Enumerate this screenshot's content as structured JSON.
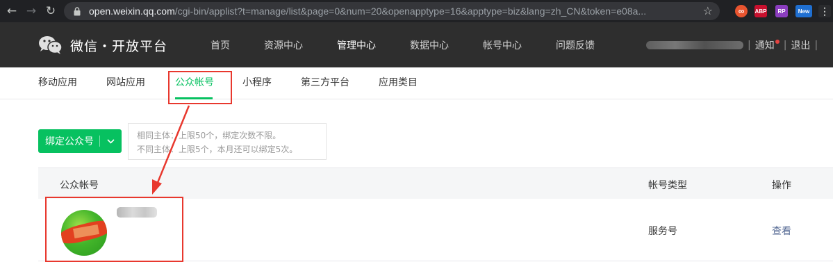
{
  "browser": {
    "url_host": "open.weixin.qq.com",
    "url_path": "/cgi-bin/applist?t=manage/list&page=0&num=20&openapptype=16&apptype=biz&lang=zh_CN&token=e08a...",
    "extensions": [
      "∞",
      "ABP",
      "RP",
      "New"
    ]
  },
  "header": {
    "logo_text": "微信・开放平台",
    "nav": [
      "首页",
      "资源中心",
      "管理中心",
      "数据中心",
      "帐号中心",
      "问题反馈"
    ],
    "active_nav": "管理中心",
    "notify_label": "通知",
    "logout_label": "退出"
  },
  "subnav": {
    "items": [
      "移动应用",
      "网站应用",
      "公众帐号",
      "小程序",
      "第三方平台",
      "应用类目"
    ],
    "active": "公众帐号"
  },
  "bind": {
    "button_label": "绑定公众号",
    "tip_line1": "相同主体：上限50个，绑定次数不限。",
    "tip_line2": "不同主体：上限5个，本月还可以绑定5次。"
  },
  "table": {
    "headers": [
      "公众帐号",
      "帐号类型",
      "操作"
    ],
    "rows": [
      {
        "account_type": "服务号",
        "action": "查看"
      }
    ]
  },
  "colors": {
    "accent": "#07c160",
    "header_bg": "#2e2e2e",
    "annotation": "#e8382e",
    "link": "#576b95"
  }
}
